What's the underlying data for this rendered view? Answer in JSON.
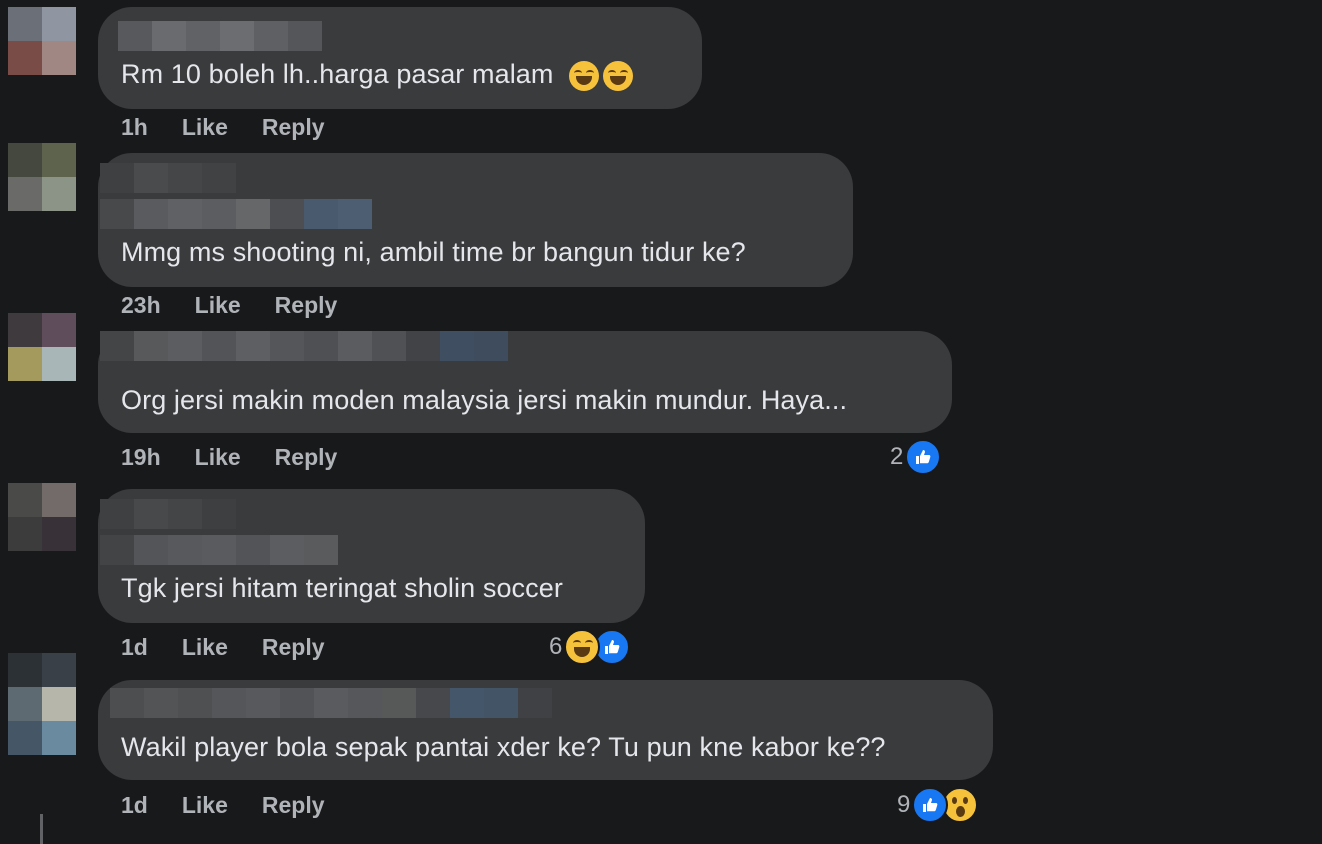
{
  "comments": [
    {
      "text": "Rm 10 boleh lh..harga pasar malam",
      "time": "1h",
      "like": "Like",
      "reply": "Reply",
      "emoji": "laughing-emoji x2"
    },
    {
      "text": "Mmg ms shooting ni, ambil time br bangun tidur ke?",
      "time": "23h",
      "like": "Like",
      "reply": "Reply"
    },
    {
      "text": "Org jersi makin moden malaysia jersi makin mundur. Haya...",
      "time": "19h",
      "like": "Like",
      "reply": "Reply",
      "reaction_count": "2"
    },
    {
      "text": "Tgk jersi hitam teringat sholin soccer",
      "time": "1d",
      "like": "Like",
      "reply": "Reply",
      "reaction_count": "6"
    },
    {
      "text": "Wakil player bola sepak pantai xder ke? Tu pun kne kabor ke??",
      "time": "1d",
      "like": "Like",
      "reply": "Reply",
      "reaction_count": "9"
    }
  ],
  "colors": {
    "background": "#18191a",
    "bubble": "#3a3b3c",
    "text": "#e4e6eb",
    "meta": "#b0b3b8",
    "like_blue": "#1877f2",
    "emoji_yellow": "#f7c23b"
  }
}
